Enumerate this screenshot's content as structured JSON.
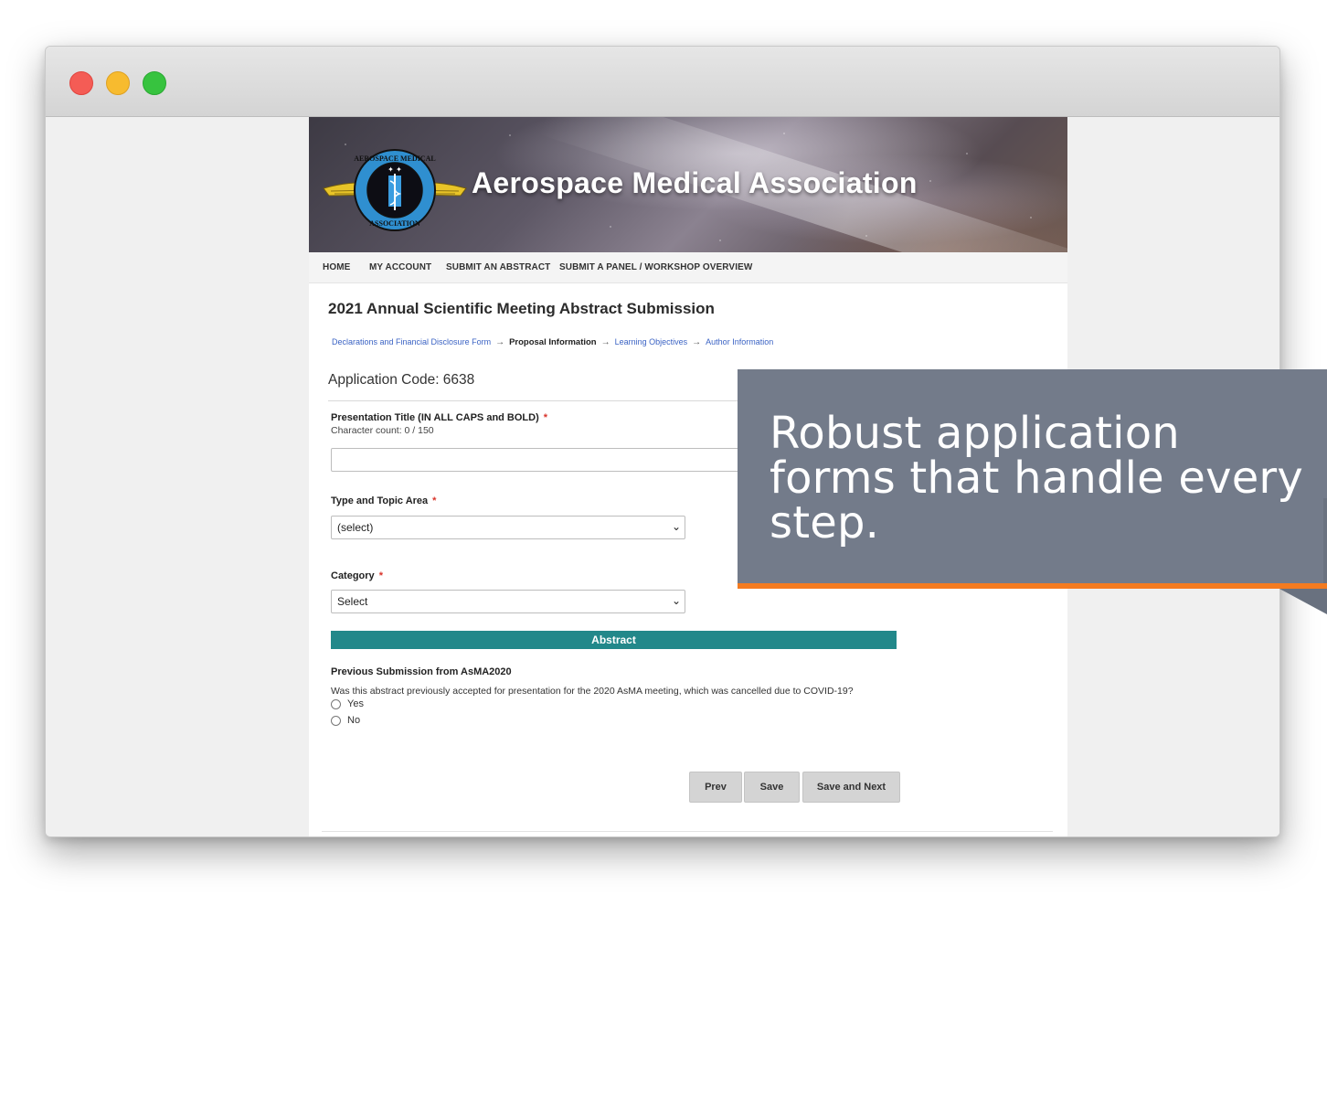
{
  "browser": {
    "controls": [
      "close",
      "minimize",
      "maximize"
    ]
  },
  "header": {
    "org_name": "Aerospace Medical Association",
    "logo_icon": "asma-winged-caduceus-logo"
  },
  "nav": {
    "items": [
      {
        "label": "HOME"
      },
      {
        "label": "MY ACCOUNT"
      },
      {
        "label": "SUBMIT AN ABSTRACT"
      },
      {
        "label": "SUBMIT A PANEL / WORKSHOP OVERVIEW"
      }
    ]
  },
  "form": {
    "title": "2021 Annual Scientific Meeting Abstract Submission",
    "steps": [
      {
        "label": "Declarations and Financial Disclosure Form",
        "state": "link"
      },
      {
        "label": "Proposal Information",
        "state": "current"
      },
      {
        "label": "Learning Objectives",
        "state": "link"
      },
      {
        "label": "Author Information",
        "state": "link"
      }
    ],
    "step_arrow": "→",
    "application_code": "Application Code: 6638",
    "presentation_title": {
      "label": "Presentation Title (IN ALL CAPS and BOLD)",
      "required_mark": "*",
      "char_count": "Character count: 0 / 150",
      "value": ""
    },
    "type_topic": {
      "label": "Type and Topic Area",
      "required_mark": "*",
      "value": "(select)"
    },
    "category": {
      "label": "Category",
      "required_mark": "*",
      "value": "Select"
    },
    "section_header": "Abstract",
    "previous_submission": {
      "heading": "Previous Submission from AsMA2020",
      "question": "Was this abstract previously accepted for presentation for the 2020 AsMA meeting, which was cancelled due to COVID-19?",
      "options": [
        "Yes",
        "No"
      ],
      "selected": null
    },
    "buttons": {
      "prev": "Prev",
      "save": "Save",
      "save_next": "Save and Next"
    }
  },
  "callout": {
    "text": "Robust application forms that handle every step.",
    "accent_color": "#f47b20",
    "background_color": "#737b8a"
  },
  "colors": {
    "section_bar": "#22888a",
    "link": "#3b63c4",
    "required": "#d9342b"
  }
}
